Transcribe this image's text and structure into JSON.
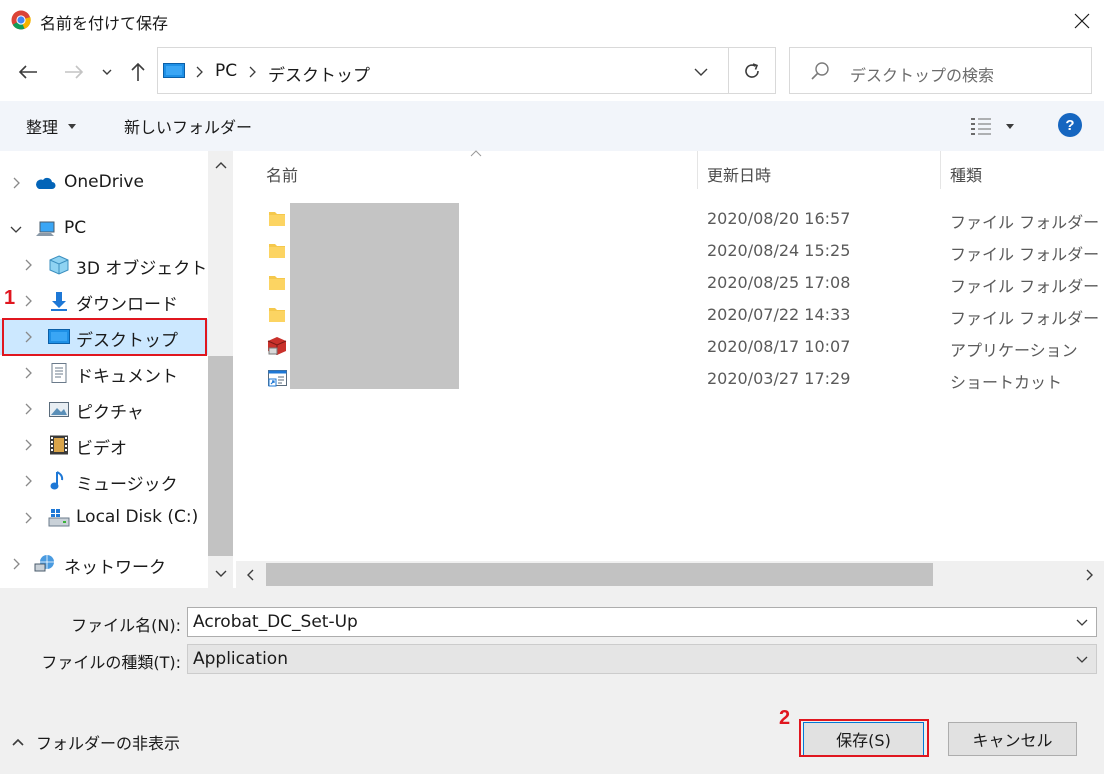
{
  "window": {
    "title": "名前を付けて保存",
    "app_icon": "chrome-icon",
    "close_icon": "close-icon"
  },
  "address": {
    "breadcrumbs": [
      "PC",
      "デスクトップ"
    ],
    "search_placeholder": "デスクトップの検索"
  },
  "toolbar": {
    "organize_label": "整理",
    "new_folder_label": "新しいフォルダー",
    "help_label": "?"
  },
  "nav": {
    "items": [
      {
        "label": "OneDrive",
        "icon": "cloud-icon"
      },
      {
        "label": "PC",
        "icon": "pc-icon"
      },
      {
        "label": "3D オブジェクト",
        "icon": "3d-objects-icon"
      },
      {
        "label": "ダウンロード",
        "icon": "download-icon"
      },
      {
        "label": "デスクトップ",
        "icon": "desktop-icon",
        "selected": true
      },
      {
        "label": "ドキュメント",
        "icon": "document-icon"
      },
      {
        "label": "ピクチャ",
        "icon": "pictures-icon"
      },
      {
        "label": "ビデオ",
        "icon": "video-icon"
      },
      {
        "label": "ミュージック",
        "icon": "music-icon"
      },
      {
        "label": "Local Disk (C:)",
        "icon": "disk-icon"
      },
      {
        "label": "ネットワーク",
        "icon": "network-icon"
      }
    ]
  },
  "filelist": {
    "columns": [
      "名前",
      "更新日時",
      "種類"
    ],
    "rows": [
      {
        "icon": "folder-icon",
        "modified": "2020/08/20 16:57",
        "type": "ファイル フォルダー"
      },
      {
        "icon": "folder-icon",
        "modified": "2020/08/24 15:25",
        "type": "ファイル フォルダー"
      },
      {
        "icon": "folder-icon",
        "modified": "2020/08/25 17:08",
        "type": "ファイル フォルダー"
      },
      {
        "icon": "folder-icon",
        "modified": "2020/07/22 14:33",
        "type": "ファイル フォルダー"
      },
      {
        "icon": "application-icon",
        "modified": "2020/08/17 10:07",
        "type": "アプリケーション"
      },
      {
        "icon": "shortcut-icon",
        "modified": "2020/03/27 17:29",
        "type": "ショートカット"
      }
    ]
  },
  "form": {
    "filename_label": "ファイル名(N):",
    "filename_value": "Acrobat_DC_Set-Up",
    "filetype_label": "ファイルの種類(T):",
    "filetype_value": "Application",
    "hide_folders_label": "フォルダーの非表示",
    "save_label": "保存(S)",
    "cancel_label": "キャンセル"
  },
  "annotations": {
    "step1": "1",
    "step2": "2"
  },
  "colors": {
    "accent": "#0078d7",
    "selection": "#cce8ff",
    "highlight_red": "#e0161f"
  }
}
